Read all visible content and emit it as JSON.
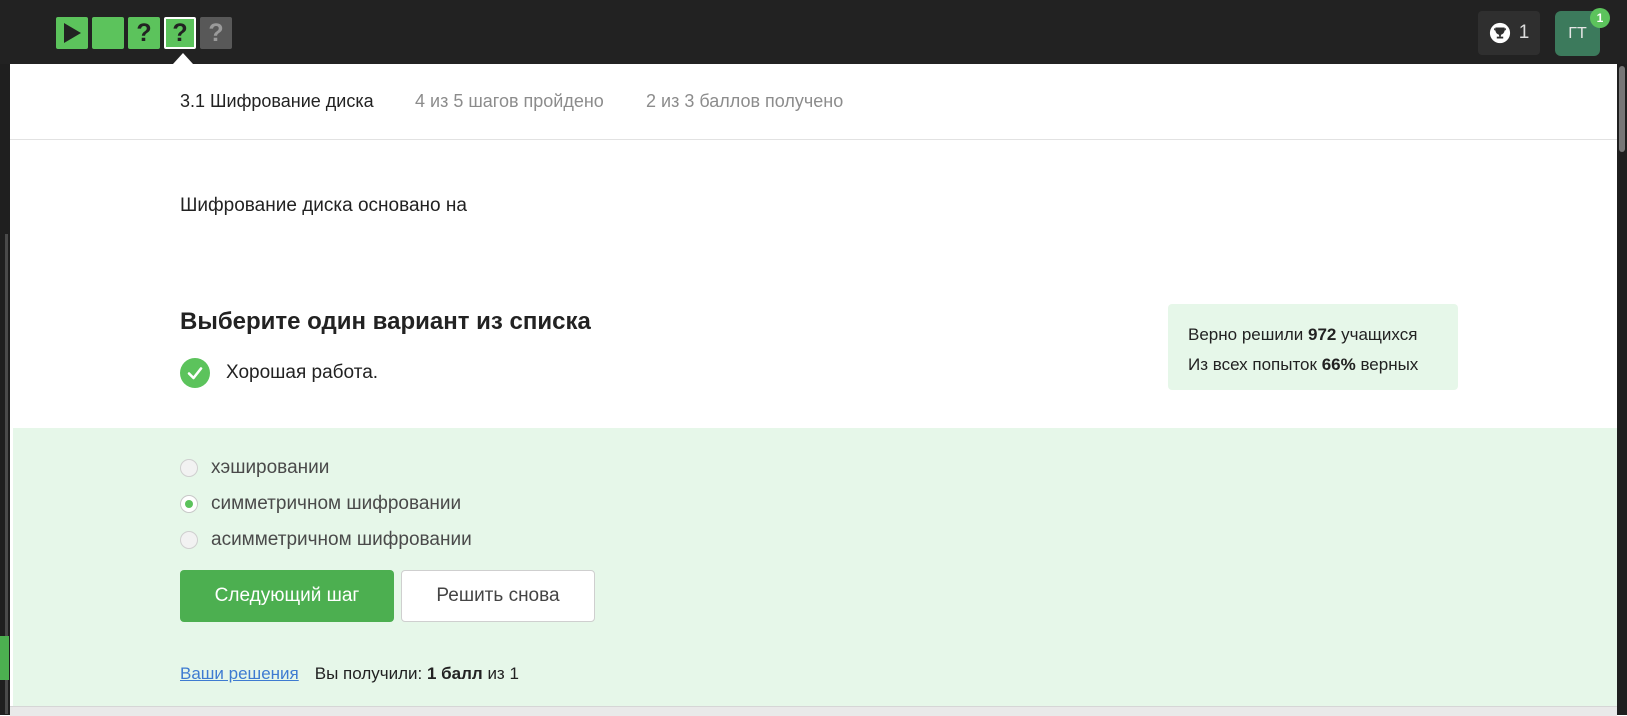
{
  "topbar": {
    "steps": [
      {
        "icon": "play-icon",
        "state": "passed"
      },
      {
        "icon": "blank",
        "state": "passed"
      },
      {
        "icon": "question",
        "label": "?",
        "state": "passed"
      },
      {
        "icon": "question",
        "label": "?",
        "state": "current"
      },
      {
        "icon": "question",
        "label": "?",
        "state": "not-passed"
      }
    ],
    "achievements_count": "1",
    "avatar_initials": "ГТ",
    "notification_count": "1"
  },
  "lesson": {
    "title": "3.1 Шифрование диска",
    "steps_progress": "4 из 5 шагов пройдено",
    "score_progress": "2 из 3 баллов  получено"
  },
  "question": {
    "text": "Шифрование диска основано на",
    "instruction": "Выберите один вариант из списка",
    "feedback": "Хорошая работа.",
    "options": [
      {
        "label": "хэшировании",
        "checked": false
      },
      {
        "label": "симметричном шифровании",
        "checked": true
      },
      {
        "label": "асимметричном шифровании",
        "checked": false
      }
    ]
  },
  "stats": {
    "solved_prefix": "Верно решили",
    "solved_count": "972",
    "solved_suffix": "учащихся",
    "attempts_prefix": "Из всех попыток",
    "attempts_percent": "66%",
    "attempts_suffix": "верных"
  },
  "actions": {
    "next_label": "Следующий шаг",
    "retry_label": "Решить снова"
  },
  "footer": {
    "solutions_link": "Ваши решения",
    "score_prefix": "Вы получили:",
    "score_value": "1 балл",
    "score_suffix": "из 1"
  },
  "colors": {
    "accent": "#4caf50",
    "step_green": "#5cc35c",
    "answer_bg": "#e6f7e9",
    "topbar": "#222222"
  }
}
